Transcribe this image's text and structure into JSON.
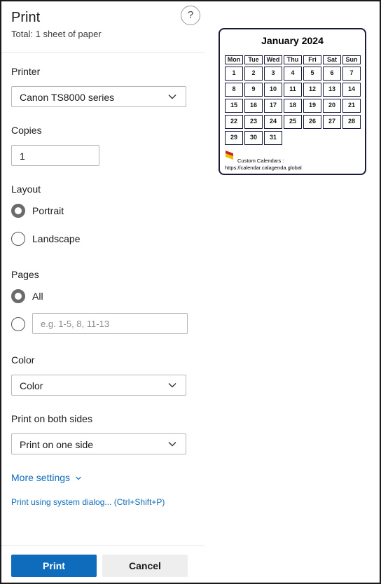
{
  "dialog": {
    "title": "Print",
    "subtitle": "Total: 1 sheet of paper",
    "help_glyph": "?"
  },
  "printer": {
    "label": "Printer",
    "selected": "Canon TS8000 series"
  },
  "copies": {
    "label": "Copies",
    "value": "1"
  },
  "layout": {
    "label": "Layout",
    "options": [
      {
        "label": "Portrait",
        "selected": true
      },
      {
        "label": "Landscape",
        "selected": false
      }
    ]
  },
  "pages": {
    "label": "Pages",
    "all_label": "All",
    "all_selected": true,
    "custom_placeholder": "e.g. 1-5, 8, 11-13"
  },
  "color": {
    "label": "Color",
    "selected": "Color"
  },
  "duplex": {
    "label": "Print on both sides",
    "selected": "Print on one side"
  },
  "more_settings": "More settings",
  "system_dialog": "Print using system dialog... (Ctrl+Shift+P)",
  "buttons": {
    "print": "Print",
    "cancel": "Cancel"
  },
  "accent_color": "#0f6cbd",
  "preview": {
    "title": "January 2024",
    "days_of_week": [
      "Mon",
      "Tue",
      "Wed",
      "Thu",
      "Fri",
      "Sat",
      "Sun"
    ],
    "weeks": [
      [
        "1",
        "2",
        "3",
        "4",
        "5",
        "6",
        "7"
      ],
      [
        "8",
        "9",
        "10",
        "11",
        "12",
        "13",
        "14"
      ],
      [
        "15",
        "16",
        "17",
        "18",
        "19",
        "20",
        "21"
      ],
      [
        "22",
        "23",
        "24",
        "25",
        "26",
        "27",
        "28"
      ],
      [
        "29",
        "30",
        "31"
      ]
    ],
    "brand_name": "Custom Calendars :",
    "brand_url": "https://calendar.calagenda.global"
  }
}
